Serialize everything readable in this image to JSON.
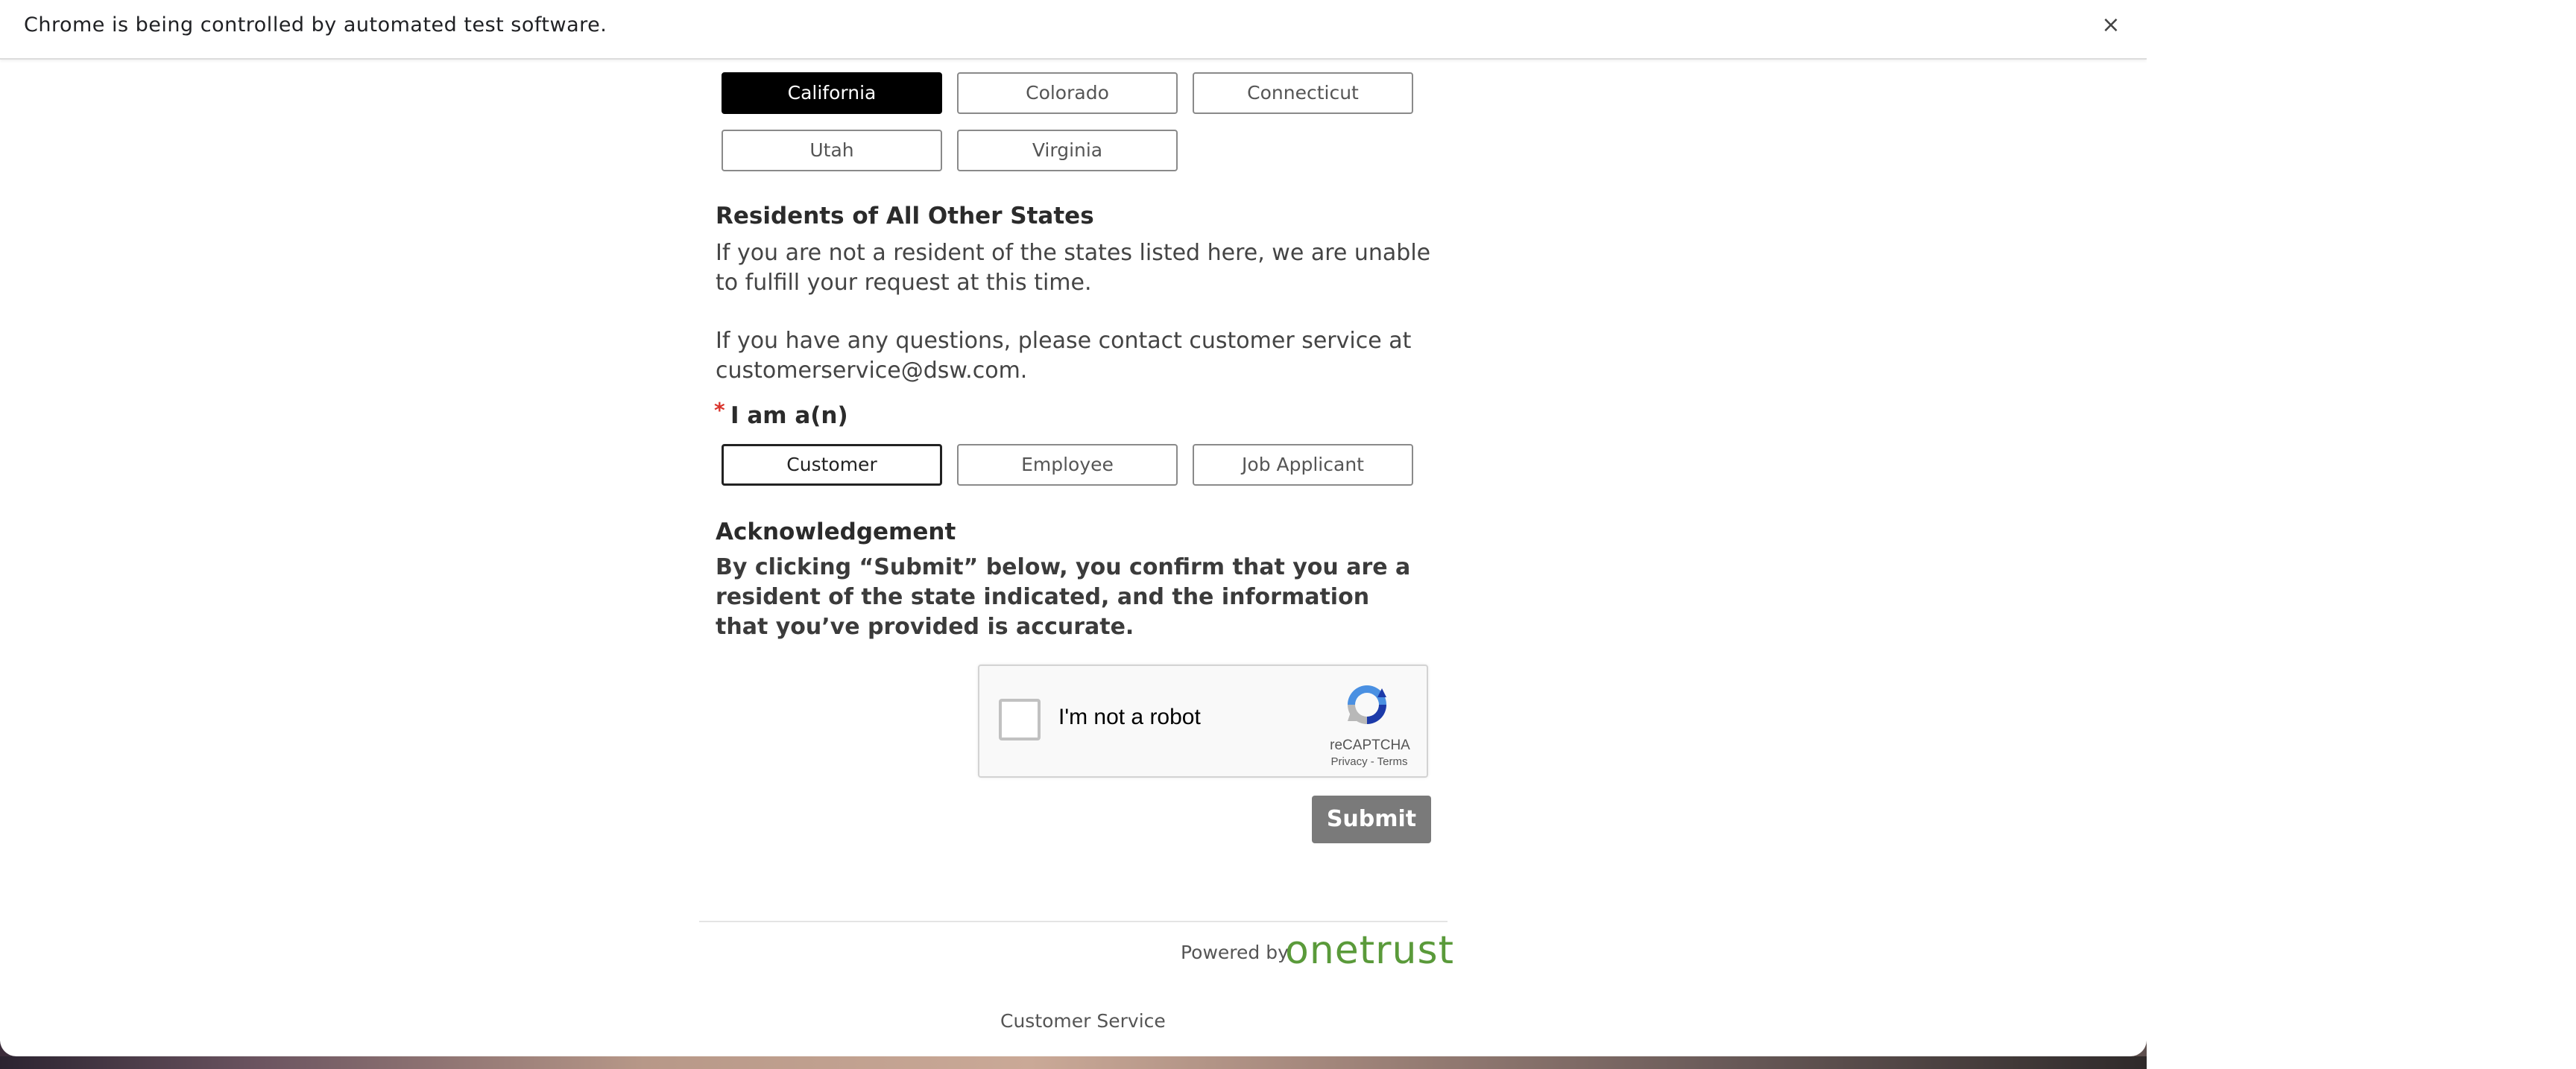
{
  "infobar": {
    "message": "Chrome is being controlled by automated test software.",
    "close_icon": "×"
  },
  "states": {
    "row1": [
      "California",
      "Colorado",
      "Connecticut"
    ],
    "row2": [
      "Utah",
      "Virginia"
    ],
    "selected": "California"
  },
  "other_states": {
    "heading": "Residents of All Other States",
    "text1": "If you are not a resident of the states listed here, we are unable to fulfill your request at this time.",
    "text2": "If you have any questions, please contact customer service at customerservice@dsw.com."
  },
  "role": {
    "required_mark": "*",
    "label": "I am a(n)",
    "options": [
      "Customer",
      "Employee",
      "Job Applicant"
    ],
    "selected": "Customer"
  },
  "acknowledgement": {
    "heading": "Acknowledgement",
    "text": "By clicking “Submit” below, you confirm that you are a resident of the state indicated, and the information that you’ve provided is accurate."
  },
  "recaptcha": {
    "label": "I'm not a robot",
    "brand": "reCAPTCHA",
    "links": "Privacy - Terms"
  },
  "submit": {
    "label": "Submit"
  },
  "footer": {
    "powered_by": "Powered by",
    "brand": "onetrust",
    "link": "Customer Service"
  },
  "colors": {
    "selected_state_bg": "#000000",
    "submit_bg": "#7a7a7a",
    "brand_green": "#5a9a3a",
    "required_red": "#d9332b"
  }
}
